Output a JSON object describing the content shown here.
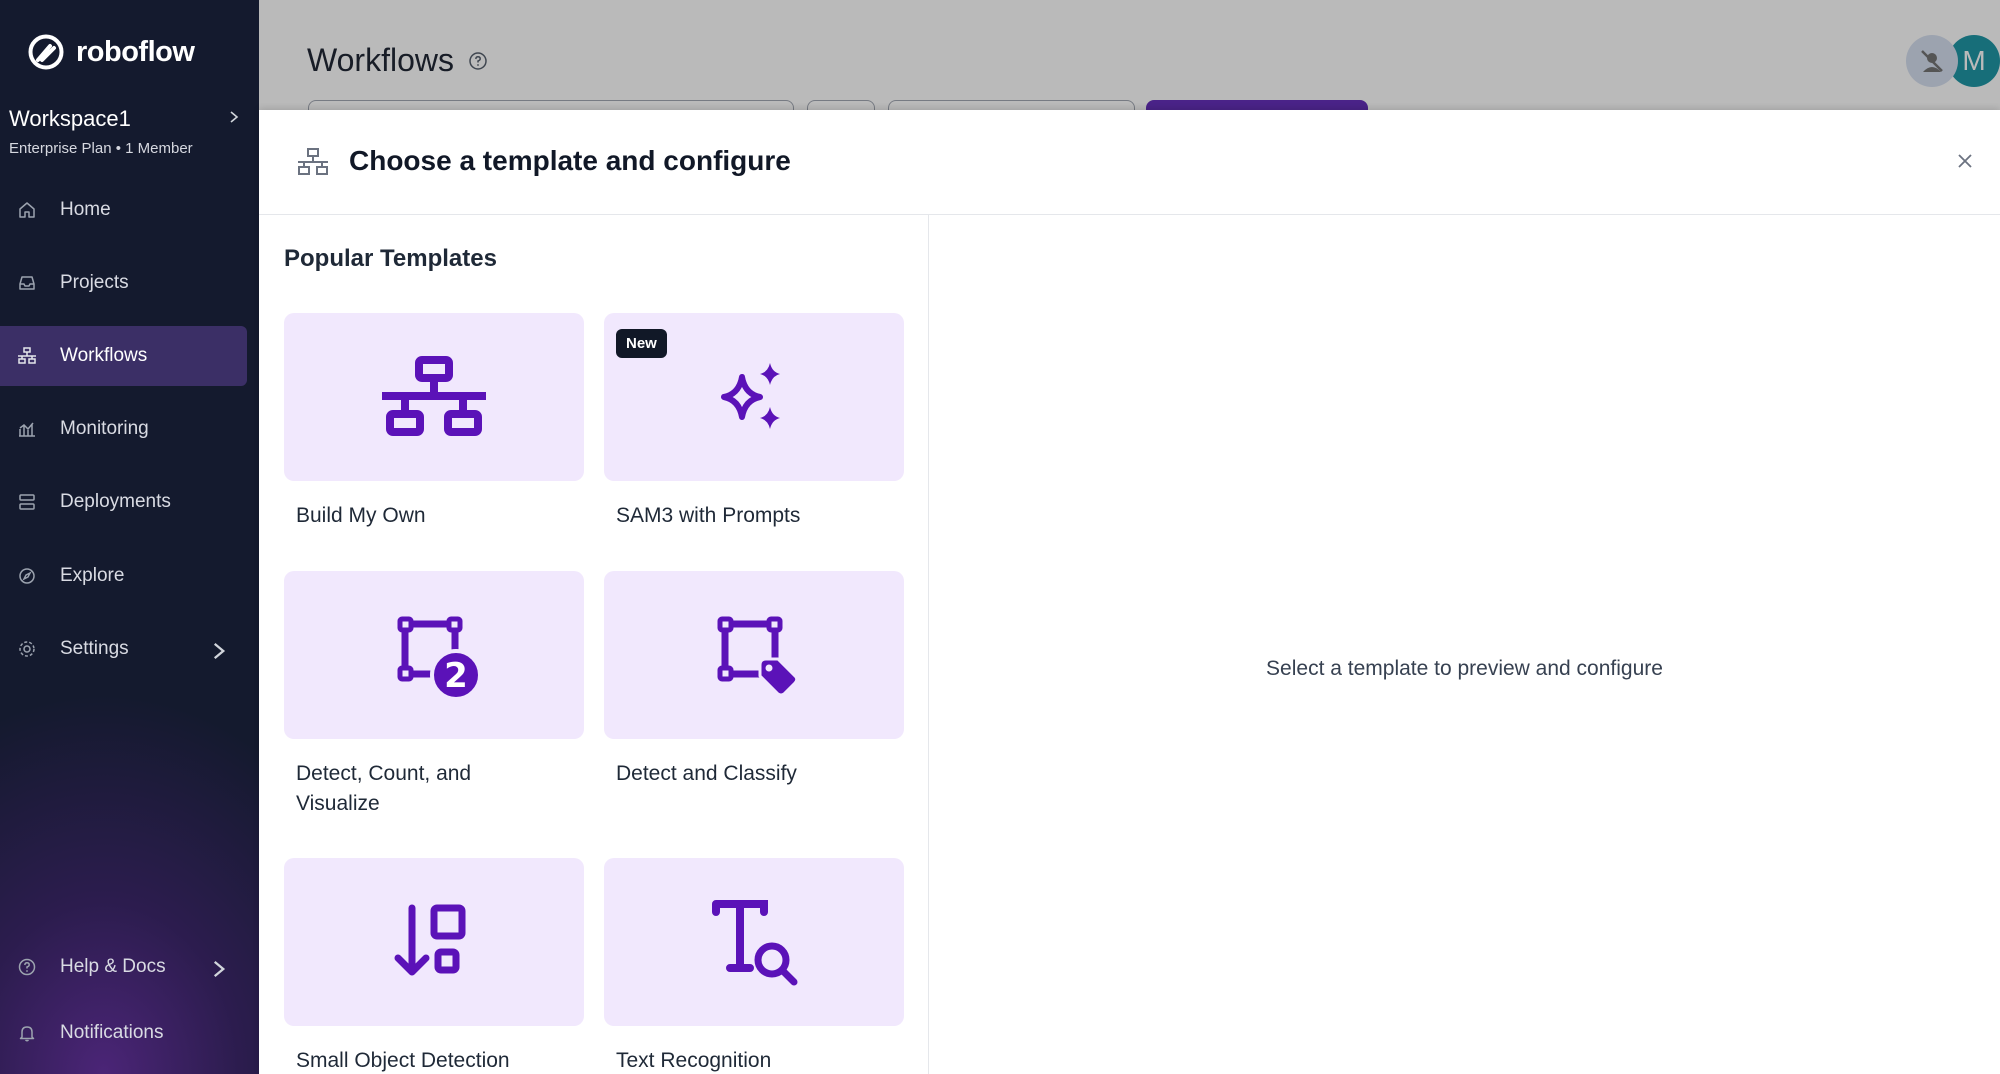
{
  "app": {
    "brand": "roboflow"
  },
  "workspace": {
    "name": "Workspace1",
    "plan": "Enterprise Plan",
    "members": "1 Member"
  },
  "sidebar": {
    "items": [
      {
        "label": "Home",
        "icon": "home-icon"
      },
      {
        "label": "Projects",
        "icon": "inbox-icon"
      },
      {
        "label": "Workflows",
        "icon": "workflow-icon",
        "active": true
      },
      {
        "label": "Monitoring",
        "icon": "chart-icon"
      },
      {
        "label": "Deployments",
        "icon": "server-icon"
      },
      {
        "label": "Explore",
        "icon": "compass-icon"
      },
      {
        "label": "Settings",
        "icon": "gear-icon"
      }
    ],
    "bottom": [
      {
        "label": "Help & Docs",
        "icon": "help-icon"
      },
      {
        "label": "Notifications",
        "icon": "bell-icon"
      }
    ]
  },
  "page": {
    "title": "Workflows"
  },
  "user": {
    "initial": "M"
  },
  "modal": {
    "title": "Choose a template and configure",
    "section_title": "Popular Templates",
    "templates": [
      {
        "label": "Build My Own",
        "icon": "workflow-icon"
      },
      {
        "label": "SAM3 with Prompts",
        "icon": "sparkles-icon",
        "badge": "New"
      },
      {
        "label": "Detect, Count, and Visualize",
        "icon": "detect-count-icon"
      },
      {
        "label": "Detect and Classify",
        "icon": "detect-tag-icon"
      },
      {
        "label": "Small Object Detection",
        "icon": "small-object-icon"
      },
      {
        "label": "Text Recognition",
        "icon": "text-search-icon"
      }
    ],
    "empty_state": "Select a template to preview and configure"
  },
  "colors": {
    "accent": "#5b12b8",
    "tile_bg": "#f1e8fd",
    "sidebar_bg": "#141a2e",
    "active_bg": "#3b2f66"
  }
}
